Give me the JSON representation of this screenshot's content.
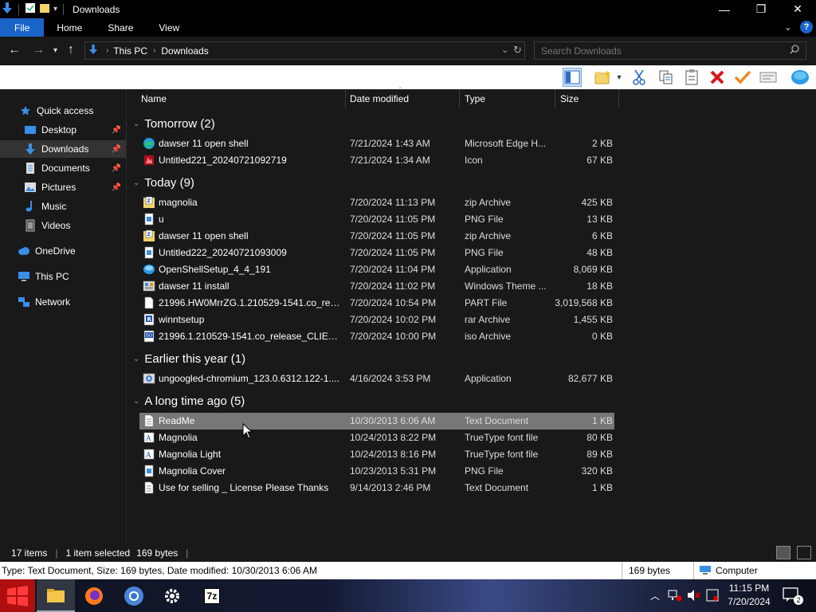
{
  "window": {
    "title": "Downloads",
    "minimize": "—",
    "maximize": "❐",
    "close": "✕"
  },
  "ribbon": {
    "tabs": [
      "File",
      "Home",
      "Share",
      "View"
    ],
    "help": "?"
  },
  "address": {
    "crumbs": [
      "This PC",
      "Downloads"
    ],
    "search_placeholder": "Search Downloads"
  },
  "nav": {
    "items": [
      {
        "label": "Quick access",
        "icon": "star-icon",
        "pinned": false
      },
      {
        "label": "Desktop",
        "icon": "desktop-icon",
        "pinned": true
      },
      {
        "label": "Downloads",
        "icon": "download-icon",
        "pinned": true,
        "selected": true
      },
      {
        "label": "Documents",
        "icon": "documents-icon",
        "pinned": true
      },
      {
        "label": "Pictures",
        "icon": "pictures-icon",
        "pinned": true
      },
      {
        "label": "Music",
        "icon": "music-icon",
        "pinned": false
      },
      {
        "label": "Videos",
        "icon": "videos-icon",
        "pinned": false
      },
      {
        "label": "OneDrive",
        "icon": "cloud-icon",
        "pinned": false
      },
      {
        "label": "This PC",
        "icon": "computer-icon",
        "pinned": false
      },
      {
        "label": "Network",
        "icon": "network-icon",
        "pinned": false
      }
    ]
  },
  "columns": {
    "name": "Name",
    "date": "Date modified",
    "type": "Type",
    "size": "Size"
  },
  "groups": [
    {
      "label": "Tomorrow (2)",
      "files": [
        {
          "name": "dawser 11 open shell",
          "date": "7/21/2024 1:43 AM",
          "type": "Microsoft Edge H...",
          "size": "2 KB",
          "icon": "edge-icon"
        },
        {
          "name": "Untitled221_20240721092719",
          "date": "7/21/2024 1:34 AM",
          "type": "Icon",
          "size": "67 KB",
          "icon": "icon-file-icon"
        }
      ]
    },
    {
      "label": "Today (9)",
      "files": [
        {
          "name": "magnolia",
          "date": "7/20/2024 11:13 PM",
          "type": "zip Archive",
          "size": "425 KB",
          "icon": "zip-icon"
        },
        {
          "name": "u",
          "date": "7/20/2024 11:05 PM",
          "type": "PNG File",
          "size": "13 KB",
          "icon": "png-icon"
        },
        {
          "name": "dawser 11 open shell",
          "date": "7/20/2024 11:05 PM",
          "type": "zip Archive",
          "size": "6 KB",
          "icon": "zip-icon"
        },
        {
          "name": "Untitled222_20240721093009",
          "date": "7/20/2024 11:05 PM",
          "type": "PNG File",
          "size": "48 KB",
          "icon": "png-icon"
        },
        {
          "name": "OpenShellSetup_4_4_191",
          "date": "7/20/2024 11:04 PM",
          "type": "Application",
          "size": "8,069 KB",
          "icon": "shell-app-icon"
        },
        {
          "name": "dawser 11 install",
          "date": "7/20/2024 11:02 PM",
          "type": "Windows Theme ...",
          "size": "18 KB",
          "icon": "theme-icon"
        },
        {
          "name": "21996.HW0MrrZG.1.210529-1541.co_relea...",
          "date": "7/20/2024 10:54 PM",
          "type": "PART File",
          "size": "3,019,568 KB",
          "icon": "blank-file-icon"
        },
        {
          "name": "winntsetup",
          "date": "7/20/2024 10:02 PM",
          "type": "rar Archive",
          "size": "1,455 KB",
          "icon": "rar-icon"
        },
        {
          "name": "21996.1.210529-1541.co_release_CLIENT_...",
          "date": "7/20/2024 10:00 PM",
          "type": "iso Archive",
          "size": "0 KB",
          "icon": "iso-icon"
        }
      ]
    },
    {
      "label": "Earlier this year (1)",
      "files": [
        {
          "name": "ungoogled-chromium_123.0.6312.122-1....",
          "date": "4/16/2024 3:53 PM",
          "type": "Application",
          "size": "82,677 KB",
          "icon": "installer-icon"
        }
      ]
    },
    {
      "label": "A long time ago (5)",
      "files": [
        {
          "name": "ReadMe",
          "date": "10/30/2013 6:06 AM",
          "type": "Text Document",
          "size": "1 KB",
          "icon": "text-file-icon",
          "selected": true
        },
        {
          "name": "Magnolia",
          "date": "10/24/2013 8:22 PM",
          "type": "TrueType font file",
          "size": "80 KB",
          "icon": "font-icon"
        },
        {
          "name": "Magnolia Light",
          "date": "10/24/2013 8:16 PM",
          "type": "TrueType font file",
          "size": "89 KB",
          "icon": "font-icon"
        },
        {
          "name": "Magnolia Cover",
          "date": "10/23/2013 5:31 PM",
          "type": "PNG File",
          "size": "320 KB",
          "icon": "png-icon"
        },
        {
          "name": "Use for selling _ License Please Thanks",
          "date": "9/14/2013 2:46 PM",
          "type": "Text Document",
          "size": "1 KB",
          "icon": "text-file-icon"
        }
      ]
    }
  ],
  "status": {
    "items": "17 items",
    "selected": "1 item selected",
    "bytes": "169 bytes"
  },
  "details": {
    "text": "Type: Text Document, Size: 169 bytes, Date modified: 10/30/2013 6:06 AM",
    "size": "169 bytes",
    "location": "Computer"
  },
  "taskbar": {
    "time": "11:15 PM",
    "date": "7/20/2024",
    "notifications": "2",
    "app7z": "7z"
  }
}
